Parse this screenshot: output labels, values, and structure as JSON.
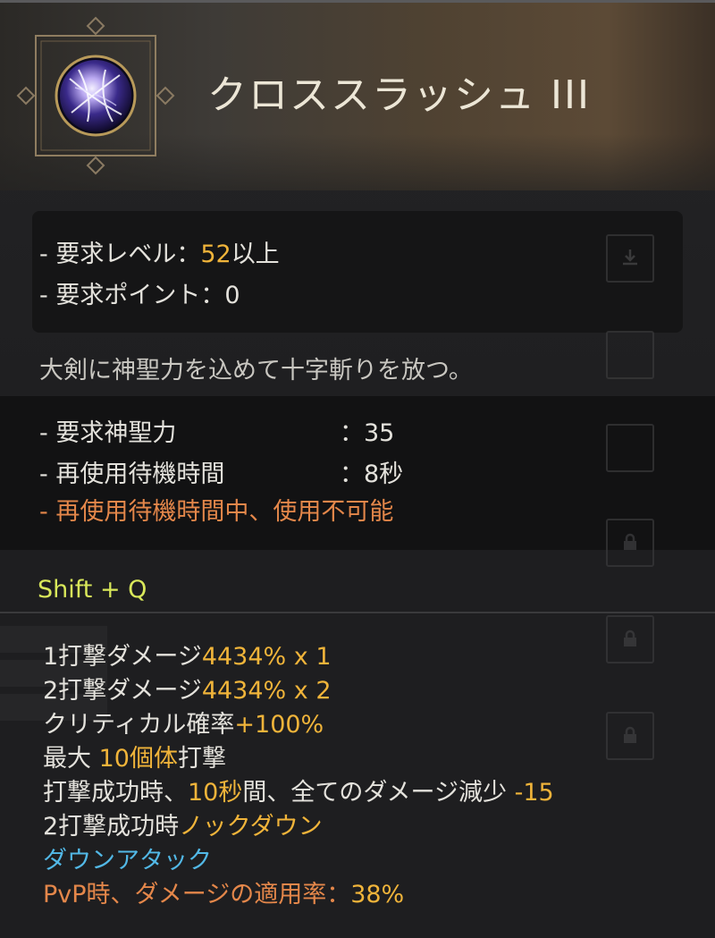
{
  "skill": {
    "title": "クロススラッシュ III",
    "icon": "cross-slash-skill-icon"
  },
  "requirements": {
    "level_prefix": "- 要求レベル：",
    "level_value": "52",
    "level_suffix": "以上",
    "points": "- 要求ポイント：0"
  },
  "description": "大剣に神聖力を込めて十字斬りを放つ。",
  "stats": {
    "holy_power_label": "- 要求神聖力",
    "holy_power_value": "：35",
    "cooldown_label": "- 再使用待機時間",
    "cooldown_value": "：8秒",
    "cooldown_warning": "- 再使用待機時間中、使用不可能"
  },
  "hotkey": "Shift + Q",
  "effects": {
    "hit1_label": "1打撃ダメージ",
    "hit1_value": "4434% x 1",
    "hit2_label": "2打撃ダメージ",
    "hit2_value": "4434% x 2",
    "crit_label": "クリティカル確率",
    "crit_value": "+100%",
    "max_prefix": "最大 ",
    "max_value": "10個体",
    "max_suffix": "打撃",
    "reduce_prefix": "打撃成功時、",
    "reduce_duration": "10秒",
    "reduce_mid": "間、全てのダメージ減少 ",
    "reduce_value": "-15",
    "knockdown_prefix": "2打撃成功時",
    "knockdown_value": "ノックダウン",
    "down_attack": "ダウンアタック",
    "pvp_prefix": "PvP時、ダメージの適用率：",
    "pvp_value": "38%"
  },
  "side_slots": [
    {
      "icon": "download-icon"
    },
    {
      "icon": "empty-slot-icon"
    },
    {
      "icon": "empty-slot-icon"
    },
    {
      "icon": "lock-icon"
    },
    {
      "icon": "lock-icon"
    },
    {
      "icon": "lock-icon"
    }
  ],
  "colors": {
    "highlight_gold": "#f0b43a",
    "warning_orange": "#e4874a",
    "hotkey_yellowgreen": "#d9e85a",
    "down_attack_cyan": "#52b8e6"
  }
}
